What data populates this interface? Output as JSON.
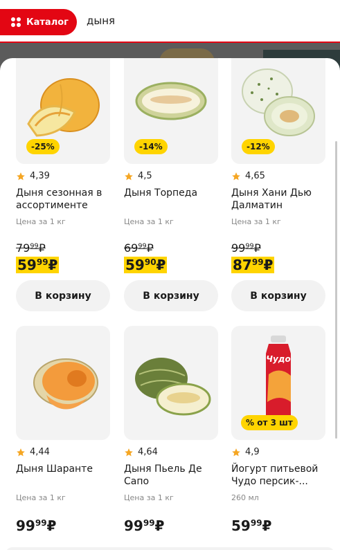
{
  "header": {
    "catalog_label": "Каталог",
    "search_value": "дыня"
  },
  "products": [
    {
      "badge": "-25%",
      "rating": "4,39",
      "title": "Дыня сезонная в ассортименте",
      "unit": "Цена за 1 кг",
      "old_main": "79",
      "old_kop": "99",
      "price_main": "59",
      "price_kop": "99",
      "cart": "В корзину"
    },
    {
      "badge": "-14%",
      "rating": "4,5",
      "title": "Дыня Торпеда",
      "unit": "Цена за 1 кг",
      "old_main": "69",
      "old_kop": "99",
      "price_main": "59",
      "price_kop": "90",
      "cart": "В корзину"
    },
    {
      "badge": "-12%",
      "rating": "4,65",
      "title": "Дыня Хани Дью Далматин",
      "unit": "Цена за 1 кг",
      "old_main": "99",
      "old_kop": "99",
      "price_main": "87",
      "price_kop": "99",
      "cart": "В корзину"
    },
    {
      "rating": "4,44",
      "title": "Дыня Шаранте",
      "unit": "Цена за 1 кг",
      "price_main": "99",
      "price_kop": "99"
    },
    {
      "rating": "4,64",
      "title": "Дыня Пьель Де Сапо",
      "unit": "Цена за 1 кг",
      "price_main": "99",
      "price_kop": "99"
    },
    {
      "badge": "% от 3 шт",
      "rating": "4,9",
      "title": "Йогурт питьевой Чудо персик-...",
      "unit": "260 мл",
      "price_main": "59",
      "price_kop": "99"
    }
  ],
  "currency": "₽",
  "colors": {
    "accent": "#e30613",
    "badge": "#ffd400"
  }
}
